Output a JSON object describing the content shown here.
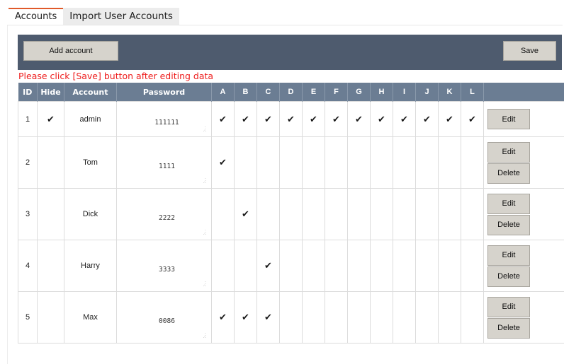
{
  "tabs": [
    {
      "label": "Accounts",
      "active": true
    },
    {
      "label": "Import User Accounts",
      "active": false
    }
  ],
  "toolbar": {
    "add_label": "Add account",
    "save_label": "Save",
    "background": "#4e5b6e"
  },
  "notice": "Please click [Save] button after editing data",
  "columns": {
    "id": "ID",
    "hide": "Hide",
    "account": "Account",
    "password": "Password",
    "letters": [
      "A",
      "B",
      "C",
      "D",
      "E",
      "F",
      "G",
      "H",
      "I",
      "J",
      "K",
      "L"
    ]
  },
  "actions": {
    "edit": "Edit",
    "delete": "Delete"
  },
  "check_glyph": "✔",
  "rows": [
    {
      "id": "1",
      "hide": true,
      "account": "admin",
      "password": "111111",
      "checks": [
        true,
        true,
        true,
        true,
        true,
        true,
        true,
        true,
        true,
        true,
        true,
        true
      ],
      "deletable": false
    },
    {
      "id": "2",
      "hide": false,
      "account": "Tom",
      "password": "1111",
      "checks": [
        true,
        false,
        false,
        false,
        false,
        false,
        false,
        false,
        false,
        false,
        false,
        false
      ],
      "deletable": true
    },
    {
      "id": "3",
      "hide": false,
      "account": "Dick",
      "password": "2222",
      "checks": [
        false,
        true,
        false,
        false,
        false,
        false,
        false,
        false,
        false,
        false,
        false,
        false
      ],
      "deletable": true
    },
    {
      "id": "4",
      "hide": false,
      "account": "Harry",
      "password": "3333",
      "checks": [
        false,
        false,
        true,
        false,
        false,
        false,
        false,
        false,
        false,
        false,
        false,
        false
      ],
      "deletable": true
    },
    {
      "id": "5",
      "hide": false,
      "account": "Max",
      "password": "0086",
      "checks": [
        true,
        true,
        true,
        false,
        false,
        false,
        false,
        false,
        false,
        false,
        false,
        false
      ],
      "deletable": true
    }
  ],
  "colors": {
    "header": "#6b7d93",
    "notice": "#ee1c1c",
    "active_tab": "#e05a2a",
    "button": "#d6d3cc"
  }
}
